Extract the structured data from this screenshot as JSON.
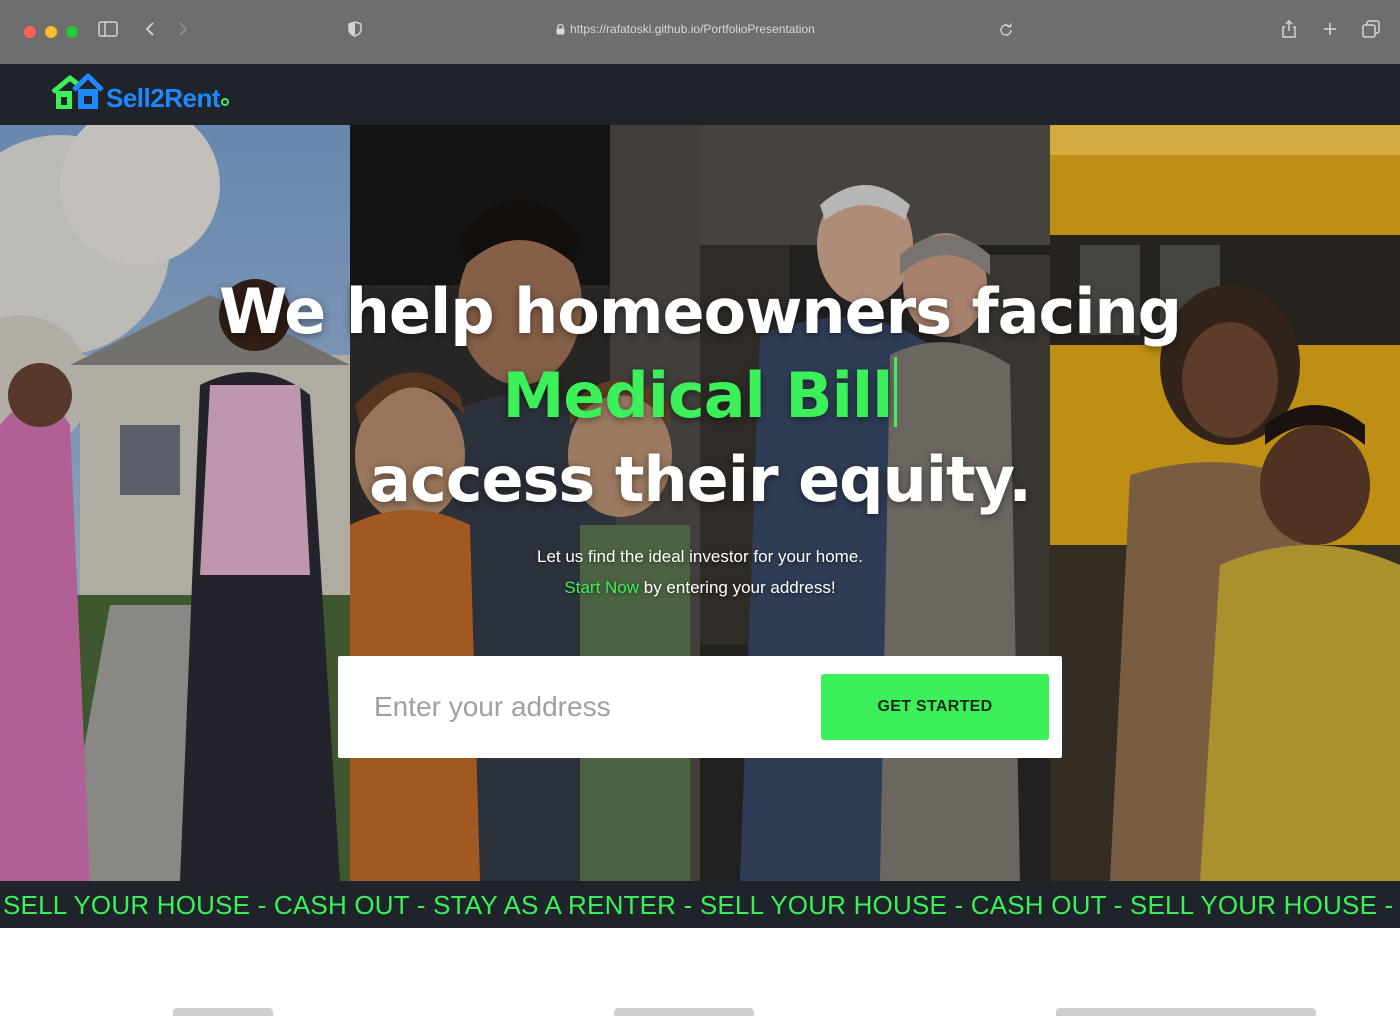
{
  "browser": {
    "url": "https://rafatoski.github.io/PortfolioPresentation",
    "icons": [
      "sidebar-icon",
      "back-icon",
      "forward-icon",
      "shield-icon",
      "lock-icon",
      "reload-icon",
      "share-icon",
      "new-tab-icon",
      "tabs-icon"
    ]
  },
  "site": {
    "logo_text": "Sell2Rent"
  },
  "hero": {
    "headline_line1": "We help homeowners facing",
    "headline_highlight": "Medical Bill",
    "headline_line3": "access their equity.",
    "subtitle_line1": "Let us find the ideal investor for your home.",
    "subtitle_cta": "Start Now",
    "subtitle_line2_rest": " by entering your address!",
    "address_placeholder": "Enter your address",
    "button_label": "GET STARTED"
  },
  "ticker": {
    "text": "SELL YOUR HOUSE - CASH OUT - STAY AS A RENTER - SELL YOUR HOUSE - CASH OUT - SELL YOUR HOUSE - CASH OUT"
  },
  "colors": {
    "accent_green": "#3cf05a",
    "logo_blue": "#1e88ff",
    "header_dark": "#1f232a"
  }
}
